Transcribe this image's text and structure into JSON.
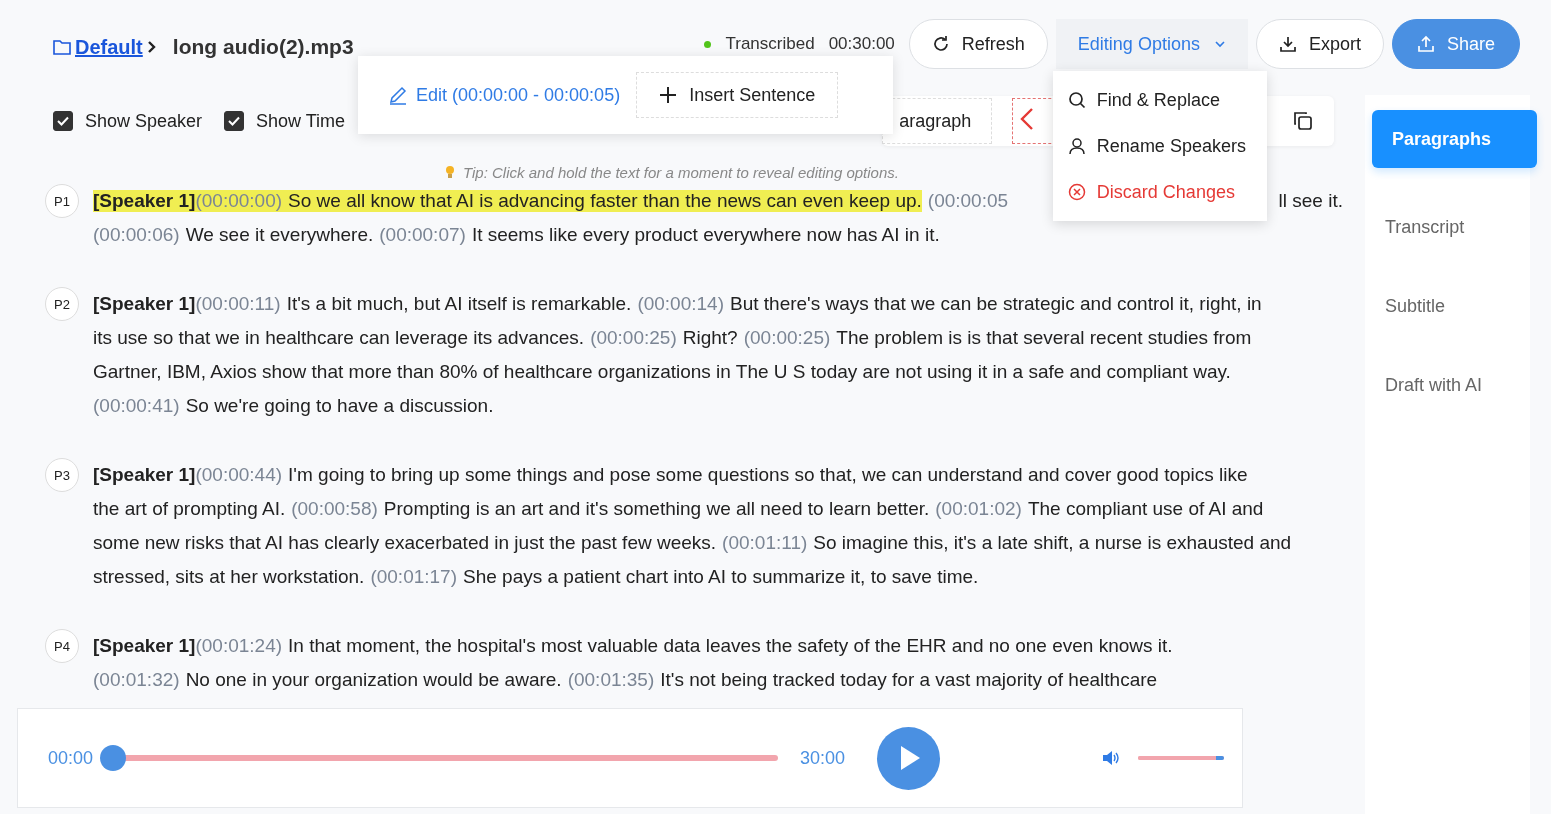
{
  "breadcrumb": {
    "folder": "Default",
    "file": "long audio(2).mp3"
  },
  "status": {
    "label": "Transcribed",
    "duration": "00:30:00"
  },
  "header_buttons": [
    {
      "kind": "refresh",
      "label": "Refresh"
    },
    {
      "kind": "menu",
      "label": "Editing Options",
      "expanded": true
    },
    {
      "kind": "export",
      "label": "Export"
    },
    {
      "kind": "share",
      "label": "Share"
    }
  ],
  "editing_menu": [
    {
      "kind": "search",
      "label": "Find & Replace"
    },
    {
      "kind": "person",
      "label": "Rename Speakers"
    },
    {
      "kind": "danger",
      "label": "Discard Changes"
    }
  ],
  "toggles": [
    {
      "label": "Show Speaker",
      "checked": true
    },
    {
      "label": "Show Time",
      "checked": true
    }
  ],
  "edit_popup": {
    "edit": "Edit (00:00:00 - 00:00:05)",
    "insert": "Insert Sentence"
  },
  "toolbar_tail": {
    "paragraph": "aragraph"
  },
  "tip": "Tip: Click and hold the text for a moment to reveal editing options.",
  "paragraphs": [
    {
      "badge": "P1",
      "lines": [
        {
          "cut": true,
          "pieces": [
            {
              "speaker": "[Speaker 1]",
              "time": "(00:00:00)",
              "text": "So we all know that AI is advancing faster than the news can even keep up.",
              "highlighted": true
            },
            {
              "time": "(00:00:05",
              "highlighted": false
            },
            {
              "text": "ll see it.",
              "highlighted": false
            }
          ]
        },
        {
          "pieces": [
            {
              "time": "(00:00:06)",
              "text": "We see it everywhere.",
              "highlighted": false
            },
            {
              "time": "(00:00:07)",
              "text": "It seems like every product everywhere now has AI in it.",
              "highlighted": false
            }
          ]
        }
      ]
    },
    {
      "badge": "P2",
      "lines": [
        {
          "pieces": [
            {
              "speaker": "[Speaker 1]",
              "time": "(00:00:11)",
              "text": "It's a bit much, but AI itself is remarkable.",
              "highlighted": false
            },
            {
              "time": "(00:00:14)",
              "text": "But there's ways that we can be strategic and control it, right, in",
              "highlighted": false
            }
          ]
        },
        {
          "pieces": [
            {
              "text": "its use so that we in healthcare can leverage its advances.",
              "highlighted": false
            },
            {
              "time": "(00:00:25)",
              "text": "Right?",
              "highlighted": false
            },
            {
              "time": "(00:00:25)",
              "text": "The problem is is that several recent studies from",
              "highlighted": false
            }
          ]
        },
        {
          "pieces": [
            {
              "text": "Gartner, IBM, Axios show that more than 80% of healthcare organizations in The U S today are not using it in a safe and compliant way.",
              "highlighted": false
            }
          ]
        },
        {
          "pieces": [
            {
              "time": "(00:00:41)",
              "text": "So we're going to have a discussion.",
              "highlighted": false
            }
          ]
        }
      ]
    },
    {
      "badge": "P3",
      "lines": [
        {
          "pieces": [
            {
              "speaker": "[Speaker 1]",
              "time": "(00:00:44)",
              "text": "I'm going to bring up some things and pose some questions so that, we can understand and cover good topics like",
              "highlighted": false
            }
          ]
        },
        {
          "pieces": [
            {
              "text": "the art of prompting AI.",
              "highlighted": false
            },
            {
              "time": "(00:00:58)",
              "text": "Prompting is an art and it's something we all need to learn better.",
              "highlighted": false
            },
            {
              "time": "(00:01:02)",
              "text": "The compliant use of AI and",
              "highlighted": false
            }
          ]
        },
        {
          "pieces": [
            {
              "text": "some new risks that AI has clearly exacerbated in just the past few weeks.",
              "highlighted": false
            },
            {
              "time": "(00:01:11)",
              "text": "So imagine this, it's a late shift, a nurse is exhausted and",
              "highlighted": false
            }
          ]
        },
        {
          "pieces": [
            {
              "text": "stressed, sits at her workstation.",
              "highlighted": false
            },
            {
              "time": "(00:01:17)",
              "text": "She pays a patient chart into AI to summarize it, to save time.",
              "highlighted": false
            }
          ]
        }
      ]
    },
    {
      "badge": "P4",
      "lines": [
        {
          "pieces": [
            {
              "speaker": "[Speaker 1]",
              "time": "(00:01:24)",
              "text": "In that moment, the hospital's most valuable data leaves the safety of the EHR and no one even knows it.",
              "highlighted": false
            }
          ]
        },
        {
          "pieces": [
            {
              "time": "(00:01:32)",
              "text": "No one in your organization would be aware.",
              "highlighted": false
            },
            {
              "time": "(00:01:35)",
              "text": "It's not being tracked today for a vast majority of healthcare",
              "highlighted": false
            }
          ]
        }
      ]
    }
  ],
  "player": {
    "current": "00:00",
    "total": "30:00",
    "level": 0,
    "volume": {
      "level": 1
    }
  },
  "side_tabs": [
    {
      "label": "Paragraphs",
      "selected": true
    },
    {
      "label": "Transcript",
      "selected": false
    },
    {
      "label": "Subtitle",
      "selected": false
    },
    {
      "label": "Draft with AI",
      "selected": false
    }
  ]
}
